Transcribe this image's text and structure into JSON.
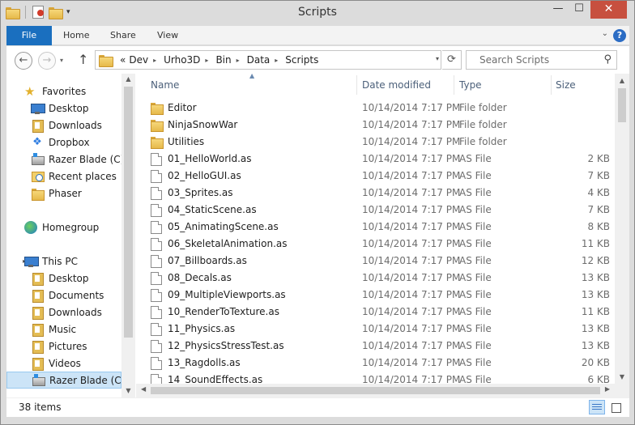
{
  "window": {
    "title": "Scripts"
  },
  "titlebar": {
    "minimize": "—",
    "maximize": "☐",
    "close": "✕",
    "qat_dropdown": "▾"
  },
  "ribbon": {
    "tabs": [
      "File",
      "Home",
      "Share",
      "View"
    ],
    "help": "?",
    "expand": "⌄"
  },
  "address": {
    "overflow": "«",
    "crumbs": [
      "Dev",
      "Urho3D",
      "Bin",
      "Data",
      "Scripts"
    ],
    "refresh": "⟳",
    "search_placeholder": "Search Scripts"
  },
  "nav": {
    "favorites": {
      "label": "Favorites",
      "items": [
        "Desktop",
        "Downloads",
        "Dropbox",
        "Razer Blade (C)",
        "Recent places",
        "Phaser"
      ]
    },
    "homegroup": {
      "label": "Homegroup"
    },
    "thispc": {
      "label": "This PC",
      "items": [
        "Desktop",
        "Documents",
        "Downloads",
        "Music",
        "Pictures",
        "Videos",
        "Razer Blade (C:)"
      ]
    }
  },
  "list": {
    "columns": {
      "name": "Name",
      "date": "Date modified",
      "type": "Type",
      "size": "Size"
    },
    "sort_indicator": "▲",
    "rows": [
      {
        "name": "Editor",
        "date": "10/14/2014 7:17 PM",
        "type": "File folder",
        "size": "",
        "kind": "folder"
      },
      {
        "name": "NinjaSnowWar",
        "date": "10/14/2014 7:17 PM",
        "type": "File folder",
        "size": "",
        "kind": "folder"
      },
      {
        "name": "Utilities",
        "date": "10/14/2014 7:17 PM",
        "type": "File folder",
        "size": "",
        "kind": "folder"
      },
      {
        "name": "01_HelloWorld.as",
        "date": "10/14/2014 7:17 PM",
        "type": "AS File",
        "size": "2 KB",
        "kind": "file"
      },
      {
        "name": "02_HelloGUI.as",
        "date": "10/14/2014 7:17 PM",
        "type": "AS File",
        "size": "7 KB",
        "kind": "file"
      },
      {
        "name": "03_Sprites.as",
        "date": "10/14/2014 7:17 PM",
        "type": "AS File",
        "size": "4 KB",
        "kind": "file"
      },
      {
        "name": "04_StaticScene.as",
        "date": "10/14/2014 7:17 PM",
        "type": "AS File",
        "size": "7 KB",
        "kind": "file"
      },
      {
        "name": "05_AnimatingScene.as",
        "date": "10/14/2014 7:17 PM",
        "type": "AS File",
        "size": "8 KB",
        "kind": "file"
      },
      {
        "name": "06_SkeletalAnimation.as",
        "date": "10/14/2014 7:17 PM",
        "type": "AS File",
        "size": "11 KB",
        "kind": "file"
      },
      {
        "name": "07_Billboards.as",
        "date": "10/14/2014 7:17 PM",
        "type": "AS File",
        "size": "12 KB",
        "kind": "file"
      },
      {
        "name": "08_Decals.as",
        "date": "10/14/2014 7:17 PM",
        "type": "AS File",
        "size": "13 KB",
        "kind": "file"
      },
      {
        "name": "09_MultipleViewports.as",
        "date": "10/14/2014 7:17 PM",
        "type": "AS File",
        "size": "13 KB",
        "kind": "file"
      },
      {
        "name": "10_RenderToTexture.as",
        "date": "10/14/2014 7:17 PM",
        "type": "AS File",
        "size": "11 KB",
        "kind": "file"
      },
      {
        "name": "11_Physics.as",
        "date": "10/14/2014 7:17 PM",
        "type": "AS File",
        "size": "13 KB",
        "kind": "file"
      },
      {
        "name": "12_PhysicsStressTest.as",
        "date": "10/14/2014 7:17 PM",
        "type": "AS File",
        "size": "13 KB",
        "kind": "file"
      },
      {
        "name": "13_Ragdolls.as",
        "date": "10/14/2014 7:17 PM",
        "type": "AS File",
        "size": "20 KB",
        "kind": "file"
      },
      {
        "name": "14_SoundEffects.as",
        "date": "10/14/2014 7:17 PM",
        "type": "AS File",
        "size": "6 KB",
        "kind": "file"
      }
    ]
  },
  "status": {
    "items_count": "38 items"
  },
  "colors": {
    "file_tab": "#1a6fbf",
    "close_button": "#c7503f",
    "selection": "#cce4f7",
    "header_text": "#4c607a"
  }
}
